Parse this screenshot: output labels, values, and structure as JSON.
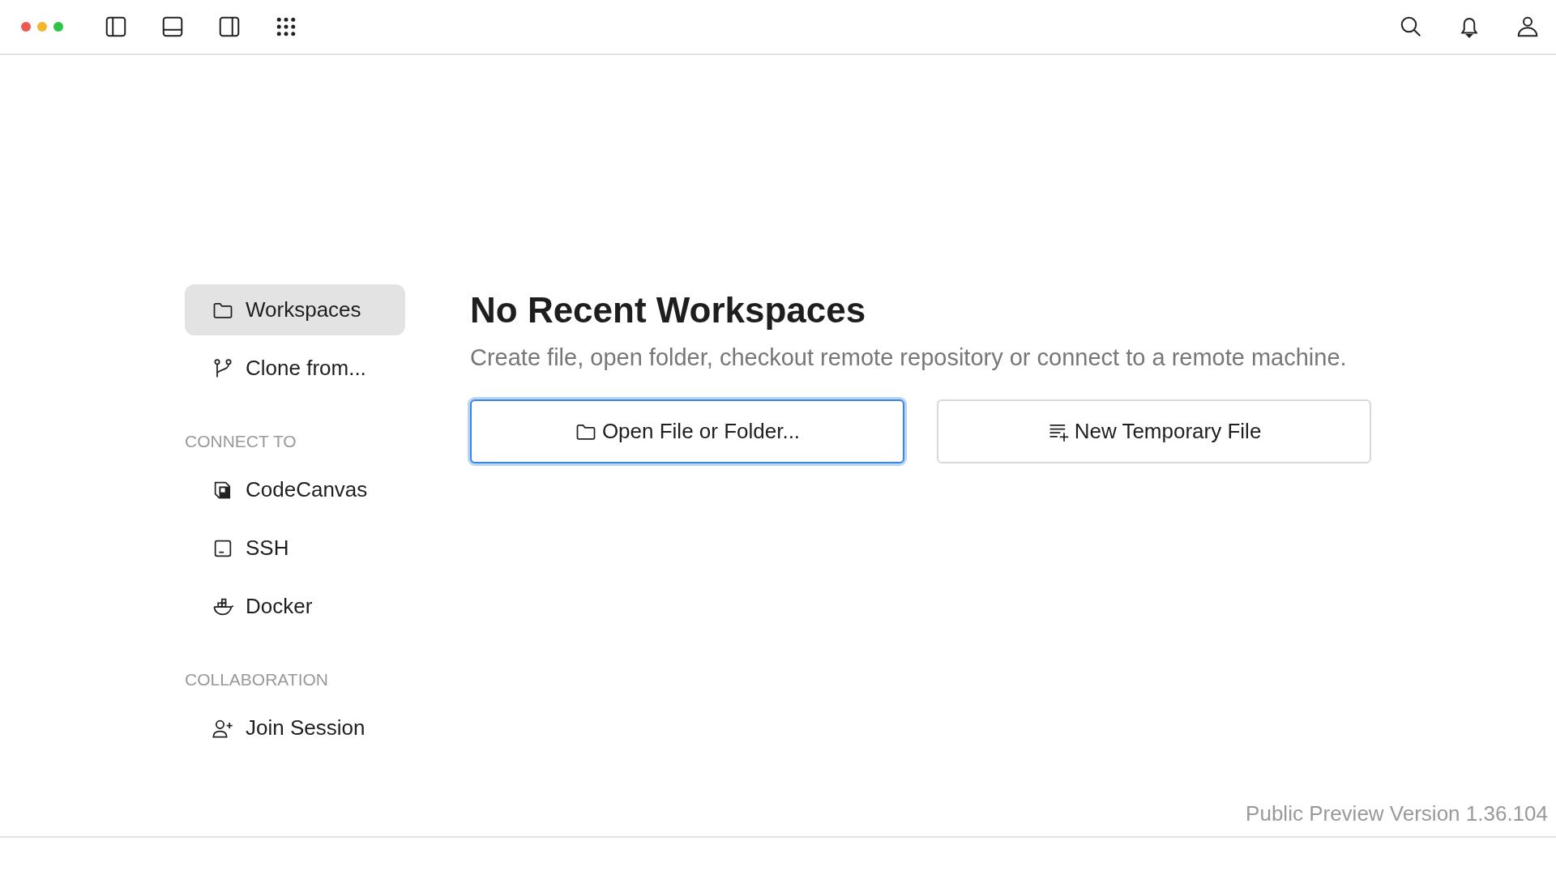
{
  "sidebar": {
    "items": [
      {
        "label": "Workspaces",
        "selected": true
      },
      {
        "label": "Clone from...",
        "selected": false
      }
    ],
    "sections": [
      {
        "heading": "CONNECT TO",
        "items": [
          {
            "label": "CodeCanvas",
            "selected": false
          },
          {
            "label": "SSH",
            "selected": false
          },
          {
            "label": "Docker",
            "selected": false
          }
        ]
      },
      {
        "heading": "COLLABORATION",
        "items": [
          {
            "label": "Join Session",
            "selected": false
          }
        ]
      }
    ]
  },
  "main": {
    "title": "No Recent Workspaces",
    "description": "Create file, open folder, checkout remote repository or connect to a remote machine.",
    "buttons": [
      {
        "label": "Open File or Folder...",
        "focused": true
      },
      {
        "label": "New Temporary File",
        "focused": false
      }
    ]
  },
  "status": {
    "version": "Public Preview Version 1.36.104"
  }
}
